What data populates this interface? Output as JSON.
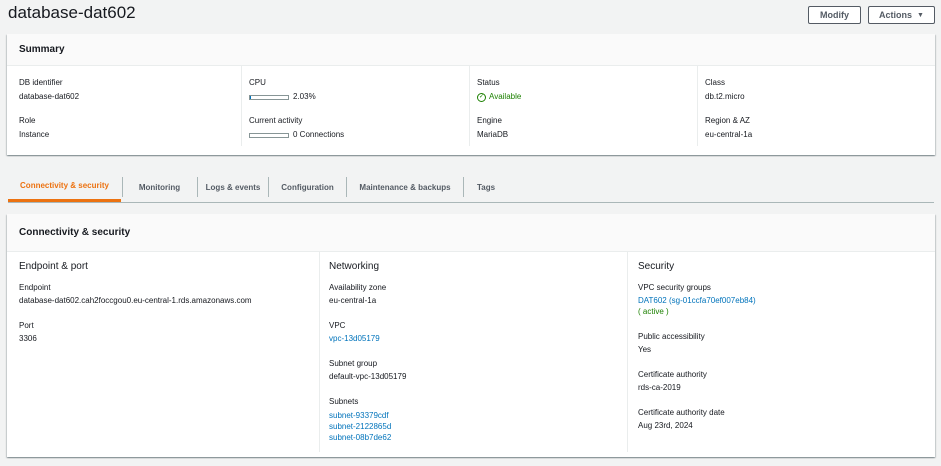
{
  "page": {
    "title": "database-dat602"
  },
  "buttons": {
    "modify": "Modify",
    "actions": "Actions"
  },
  "summary": {
    "title": "Summary",
    "db_identifier": {
      "label": "DB identifier",
      "value": "database-dat602"
    },
    "role": {
      "label": "Role",
      "value": "Instance"
    },
    "cpu": {
      "label": "CPU",
      "value": "2.03%",
      "fraction": 0.0203
    },
    "current_activity": {
      "label": "Current activity",
      "value": "0 Connections",
      "fraction": 0
    },
    "status": {
      "label": "Status",
      "value": "Available",
      "color": "#1d8102"
    },
    "engine": {
      "label": "Engine",
      "value": "MariaDB"
    },
    "class": {
      "label": "Class",
      "value": "db.t2.micro"
    },
    "region": {
      "label": "Region & AZ",
      "value": "eu-central-1a"
    }
  },
  "tabs": [
    {
      "label": "Connectivity & security",
      "active": true
    },
    {
      "label": "Monitoring"
    },
    {
      "label": "Logs & events"
    },
    {
      "label": "Configuration"
    },
    {
      "label": "Maintenance & backups"
    },
    {
      "label": "Tags"
    }
  ],
  "connectivity": {
    "title": "Connectivity & security",
    "endpoint_port": {
      "heading": "Endpoint & port",
      "endpoint_label": "Endpoint",
      "endpoint_value": "database-dat602.cah2foccgou0.eu-central-1.rds.amazonaws.com",
      "port_label": "Port",
      "port_value": "3306"
    },
    "networking": {
      "heading": "Networking",
      "az_label": "Availability zone",
      "az_value": "eu-central-1a",
      "vpc_label": "VPC",
      "vpc_value": "vpc-13d05179",
      "subnet_group_label": "Subnet group",
      "subnet_group_value": "default-vpc-13d05179",
      "subnets_label": "Subnets",
      "subnets": [
        "subnet-93379cdf",
        "subnet-2122865d",
        "subnet-08b7de62"
      ]
    },
    "security": {
      "heading": "Security",
      "sg_label": "VPC security groups",
      "sg_value": "DAT602 (sg-01ccfa70ef007eb84)",
      "sg_status": "( active )",
      "public_label": "Public accessibility",
      "public_value": "Yes",
      "ca_label": "Certificate authority",
      "ca_value": "rds-ca-2019",
      "ca_date_label": "Certificate authority date",
      "ca_date_value": "Aug 23rd, 2024"
    }
  },
  "colors": {
    "accent": "#ec7211",
    "link": "#0073bb",
    "success": "#1d8102"
  }
}
